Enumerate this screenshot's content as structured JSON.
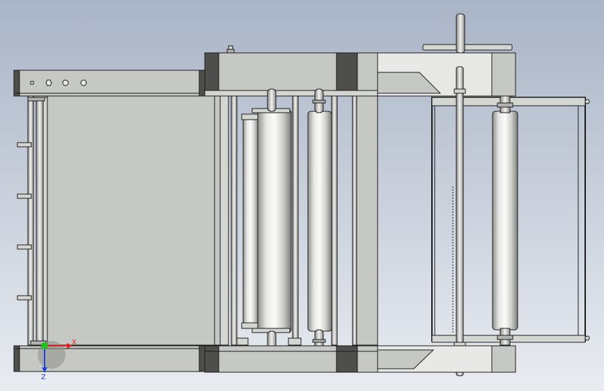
{
  "viewport": {
    "background_top": "#a9b4c6",
    "background_bottom": "#e9ecf1"
  },
  "palette": {
    "body": "#c6c8c3",
    "body_light": "#d4d6d1",
    "body_dark": "#b2b4af",
    "plate_dark": "#4e4f4c",
    "edge": "#1a1a1a",
    "white_panel": "#e8e9e6"
  },
  "triad": {
    "x_label": "X",
    "z_label": "Z",
    "x_color": "#e02020",
    "y_color": "#20c020",
    "z_color": "#2040e0"
  }
}
